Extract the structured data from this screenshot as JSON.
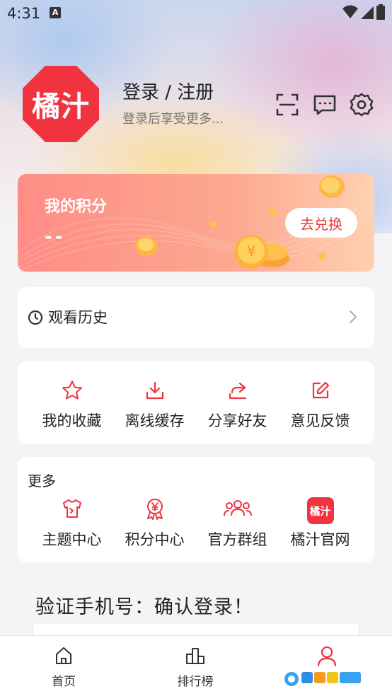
{
  "status_bar": {
    "time": "4:31",
    "notification_badge": "A"
  },
  "header": {
    "avatar_text": "橘汁",
    "login_title": "登录 / 注册",
    "login_subtitle": "登录后享受更多...",
    "icons": [
      "scan-icon",
      "message-icon",
      "settings-icon"
    ]
  },
  "points_card": {
    "title": "我的积分",
    "value": "--",
    "redeem_label": "去兑换"
  },
  "history": {
    "label": "观看历史"
  },
  "quick_actions": [
    {
      "label": "我的收藏",
      "icon": "star-icon"
    },
    {
      "label": "离线缓存",
      "icon": "download-icon"
    },
    {
      "label": "分享好友",
      "icon": "share-icon"
    },
    {
      "label": "意见反馈",
      "icon": "edit-icon"
    }
  ],
  "more": {
    "title": "更多",
    "items": [
      {
        "label": "主题中心",
        "icon": "shirt-icon"
      },
      {
        "label": "积分中心",
        "icon": "yuan-badge-icon"
      },
      {
        "label": "官方群组",
        "icon": "group-icon"
      },
      {
        "label": "橘汁官网",
        "icon": "app-logo-icon",
        "icon_text": "橘汁"
      }
    ]
  },
  "promo": {
    "text": "验证手机号：确认登录！"
  },
  "tabbar": {
    "tabs": [
      {
        "label": "首页",
        "icon": "home-icon"
      },
      {
        "label": "排行榜",
        "icon": "ranking-icon"
      },
      {
        "label": "",
        "icon": "profile-icon",
        "active": true
      }
    ]
  },
  "colors": {
    "accent": "#f0333f",
    "points_card": "#fe8c86",
    "background": "#f4f4f6"
  }
}
